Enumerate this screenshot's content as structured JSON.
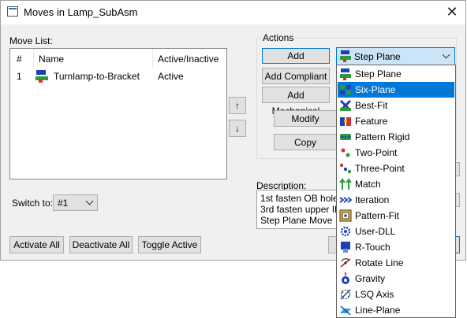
{
  "window": {
    "title": "Moves in Lamp_SubAsm",
    "close_glyph": "✕"
  },
  "move_list": {
    "label": "Move List:",
    "columns": [
      "#",
      "Name",
      "Active/Inactive"
    ],
    "rows": [
      {
        "num": "1",
        "name": "Turnlamp-to-Bracket",
        "status": "Active",
        "icon": "step-plane-icon"
      }
    ]
  },
  "reorder": {
    "up_glyph": "↑",
    "down_glyph": "↓"
  },
  "actions": {
    "label": "Actions",
    "add": "Add",
    "add_compliant": "Add Compliant",
    "add_mechanical": "Add Mechanical",
    "modify": "Modify",
    "copy": "Copy"
  },
  "move_type": {
    "selected": "Step Plane",
    "options": [
      {
        "label": "Step Plane",
        "icon": "step-plane-icon"
      },
      {
        "label": "Six-Plane",
        "icon": "six-plane-icon",
        "highlighted": true
      },
      {
        "label": "Best-Fit",
        "icon": "best-fit-icon"
      },
      {
        "label": "Feature",
        "icon": "feature-icon"
      },
      {
        "label": "Pattern Rigid",
        "icon": "pattern-rigid-icon"
      },
      {
        "label": "Two-Point",
        "icon": "two-point-icon"
      },
      {
        "label": "Three-Point",
        "icon": "three-point-icon"
      },
      {
        "label": "Match",
        "icon": "match-icon"
      },
      {
        "label": "Iteration",
        "icon": "iteration-icon"
      },
      {
        "label": "Pattern-Fit",
        "icon": "pattern-fit-icon"
      },
      {
        "label": "User-DLL",
        "icon": "user-dll-icon"
      },
      {
        "label": "R-Touch",
        "icon": "r-touch-icon"
      },
      {
        "label": "Rotate Line",
        "icon": "rotate-line-icon"
      },
      {
        "label": "Gravity",
        "icon": "gravity-icon"
      },
      {
        "label": "LSQ Axis",
        "icon": "lsq-axis-icon"
      },
      {
        "label": "Line-Plane",
        "icon": "line-plane-icon"
      }
    ],
    "highlight_color": "#0078d7"
  },
  "description": {
    "label": "Description:",
    "lines": [
      "1st fasten OB hole,",
      "3rd fasten upper IB",
      "Step Plane Move"
    ]
  },
  "switch_to": {
    "label": "Switch to:",
    "value": "#1"
  },
  "bottom_buttons": {
    "activate_all": "Activate All",
    "deactivate_all": "Deactivate All",
    "toggle_active": "Toggle Active"
  }
}
